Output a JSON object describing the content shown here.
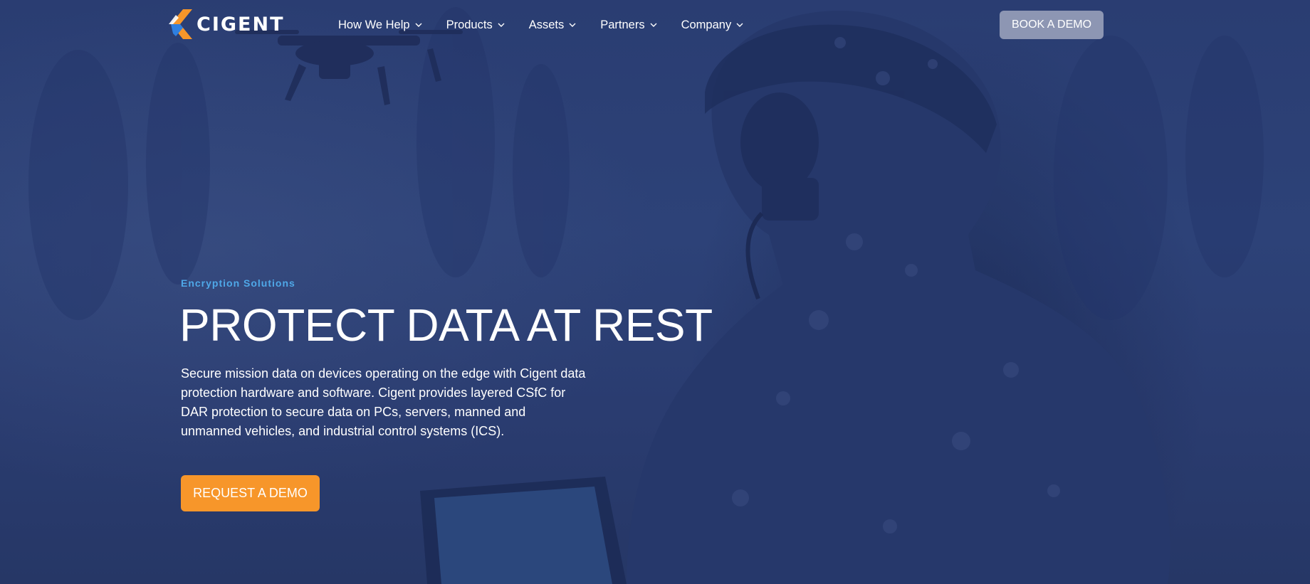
{
  "brand": {
    "name": "CIGENT",
    "logo_colors": {
      "orange": "#f7962a",
      "blue": "#2f7fe0"
    }
  },
  "nav": {
    "items": [
      {
        "label": "How We Help",
        "icon": "chevron-down-icon"
      },
      {
        "label": "Products",
        "icon": "chevron-down-icon"
      },
      {
        "label": "Assets",
        "icon": "chevron-down-icon"
      },
      {
        "label": "Partners",
        "icon": "chevron-down-icon"
      },
      {
        "label": "Company",
        "icon": "chevron-down-icon"
      }
    ],
    "book_demo_label": "BOOK A DEMO"
  },
  "hero": {
    "eyebrow": "Encryption Solutions",
    "headline": "PROTECT DATA AT REST",
    "description": "Secure mission data on devices operating on the edge with Cigent data protection hardware and software. Cigent provides layered CSfC for DAR protection to secure data on PCs, servers, manned and unmanned vehicles, and industrial control systems (ICS).",
    "cta_label": "REQUEST A DEMO"
  },
  "colors": {
    "overlay_blue": "#2d4278",
    "eyebrow_blue": "#4fa8e8",
    "cta_orange": "#f7962a",
    "book_demo_bg": "#8d96b3",
    "text": "#ffffff"
  }
}
